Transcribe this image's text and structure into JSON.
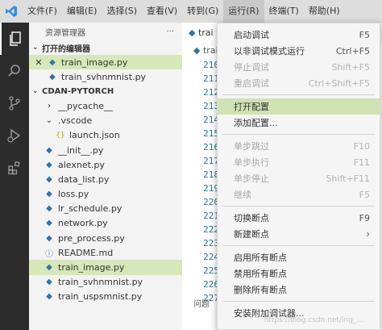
{
  "menubar": {
    "items": [
      "文件(F)",
      "编辑(E)",
      "选择(S)",
      "查看(V)",
      "转到(G)",
      "运行(R)",
      "终端(T)",
      "帮助(H)"
    ]
  },
  "sidebar": {
    "title": "资源管理器",
    "more": "···",
    "open_editors": {
      "title": "打开的编辑器",
      "files": [
        "train_image.py",
        "train_svhnmnist.py"
      ]
    },
    "project": {
      "title": "CDAN-PYTORCH",
      "items": [
        "__pycache__",
        ".vscode",
        "launch.json",
        "__init__.py",
        "alexnet.py",
        "data_list.py",
        "loss.py",
        "lr_schedule.py",
        "network.py",
        "pre_process.py",
        "README.md",
        "train_image.py",
        "train_svhnmnist.py",
        "train_uspsmnist.py"
      ]
    }
  },
  "editor": {
    "tab_label": "trai",
    "breadcrumb": "trai",
    "line_numbers": [
      "210",
      "211",
      "212",
      "213",
      "214",
      "215",
      "216",
      "217",
      "218",
      "219",
      "220",
      "221",
      "222",
      "223",
      "224",
      "225",
      "226",
      "227"
    ],
    "panel_tab": "问题"
  },
  "run_menu": {
    "start_debugging": {
      "label": "启动调试",
      "key": "F5"
    },
    "run_without_debugging": {
      "label": "以非调试模式运行",
      "key": "Ctrl+F5"
    },
    "stop_debugging": {
      "label": "停止调试",
      "key": "Shift+F5"
    },
    "restart_debugging": {
      "label": "重启调试",
      "key": "Ctrl+Shift+F5"
    },
    "open_configurations": {
      "label": "打开配置",
      "key": ""
    },
    "add_configuration": {
      "label": "添加配置...",
      "key": ""
    },
    "step_over": {
      "label": "单步跳过",
      "key": "F10"
    },
    "step_into": {
      "label": "单步执行",
      "key": "F11"
    },
    "step_out": {
      "label": "单步停止",
      "key": "Shift+F11"
    },
    "continue": {
      "label": "继续",
      "key": "F5"
    },
    "toggle_breakpoint": {
      "label": "切换断点",
      "key": "F9"
    },
    "new_breakpoint": {
      "label": "新建断点",
      "key": ""
    },
    "enable_all_breakpoints": {
      "label": "启用所有断点",
      "key": ""
    },
    "disable_all_breakpoints": {
      "label": "禁用所有断点",
      "key": ""
    },
    "remove_all_breakpoints": {
      "label": "删除所有断点",
      "key": ""
    },
    "install_debuggers": {
      "label": "安装附加调试器...",
      "key": ""
    }
  },
  "watermark": "https://blog.csdn.net/ing_...",
  "colors": {
    "selection": "#d6e8b8",
    "menu_hover": "#cfe3b2",
    "activity_bar": "#2c2c2c",
    "python_icon": "#3572a5",
    "line_number": "#237893"
  }
}
